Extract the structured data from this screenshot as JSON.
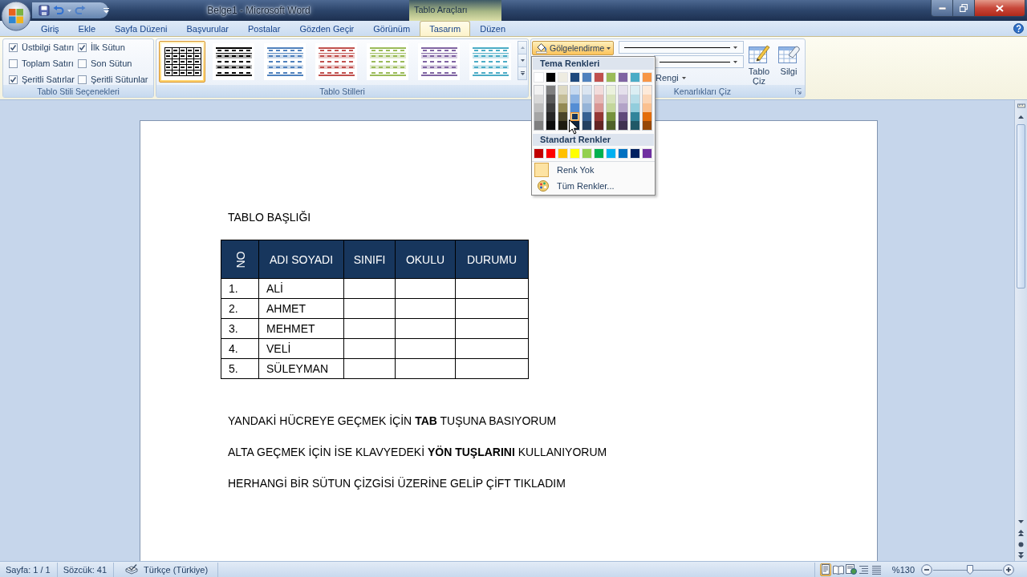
{
  "title_bar": {
    "title": "Belge1 - Microsoft Word",
    "context_label": "Tablo Araçları"
  },
  "tabs": [
    {
      "label": "Giriş",
      "selected": false
    },
    {
      "label": "Ekle",
      "selected": false
    },
    {
      "label": "Sayfa Düzeni",
      "selected": false
    },
    {
      "label": "Başvurular",
      "selected": false
    },
    {
      "label": "Postalar",
      "selected": false
    },
    {
      "label": "Gözden Geçir",
      "selected": false
    },
    {
      "label": "Görünüm",
      "selected": false
    },
    {
      "label": "Tasarım",
      "selected": true
    },
    {
      "label": "Düzen",
      "selected": false
    }
  ],
  "style_options": {
    "label": "Tablo Stili Seçenekleri",
    "options": [
      {
        "label": "Üstbilgi Satırı",
        "checked": true
      },
      {
        "label": "İlk Sütun",
        "checked": true
      },
      {
        "label": "Toplam Satırı",
        "checked": false
      },
      {
        "label": "Son Sütun",
        "checked": false
      },
      {
        "label": "Şeritli Satırlar",
        "checked": true
      },
      {
        "label": "Şeritli Sütunlar",
        "checked": false
      }
    ]
  },
  "table_styles": {
    "label": "Tablo Stilleri",
    "styles": [
      {
        "kind": "grid",
        "color": "#000000",
        "selected": true
      },
      {
        "kind": "banded",
        "color": "#000000",
        "selected": false
      },
      {
        "kind": "banded",
        "color": "#4f81bd",
        "selected": false
      },
      {
        "kind": "banded",
        "color": "#c0504d",
        "selected": false
      },
      {
        "kind": "banded",
        "color": "#9bbb59",
        "selected": false
      },
      {
        "kind": "banded",
        "color": "#8064a2",
        "selected": false
      },
      {
        "kind": "banded",
        "color": "#4bacc6",
        "selected": false
      }
    ]
  },
  "borders": {
    "label": "Kenarlıkları Çiz",
    "shading": {
      "label": "Gölgelendirme",
      "expanded": true
    },
    "pen_color": {
      "label": "Rengi"
    },
    "draw_table": {
      "label": "Tablo Çiz"
    },
    "eraser": {
      "label": "Silgi"
    }
  },
  "color_menu": {
    "theme_heading": "Tema Renkleri",
    "theme_colors": [
      {
        "color": "#ffffff",
        "selected": false
      },
      {
        "color": "#000000",
        "selected": false
      },
      {
        "color": "#eeece1",
        "selected": false
      },
      {
        "color": "#1f497d",
        "selected": false
      },
      {
        "color": "#4f81bd",
        "selected": false
      },
      {
        "color": "#c0504d",
        "selected": false
      },
      {
        "color": "#9bbb59",
        "selected": false
      },
      {
        "color": "#8064a2",
        "selected": false
      },
      {
        "color": "#4bacc6",
        "selected": false
      },
      {
        "color": "#f79646",
        "selected": false
      }
    ],
    "theme_shades": [
      [
        {
          "color": "#f2f2f2",
          "selected": false
        },
        {
          "color": "#7f7f7f",
          "selected": false
        },
        {
          "color": "#ddd9c3",
          "selected": false
        },
        {
          "color": "#c6d9f0",
          "selected": false
        },
        {
          "color": "#dbe5f1",
          "selected": false
        },
        {
          "color": "#f2dcdb",
          "selected": false
        },
        {
          "color": "#ebf1dd",
          "selected": false
        },
        {
          "color": "#e5e0ec",
          "selected": false
        },
        {
          "color": "#dbeef3",
          "selected": false
        },
        {
          "color": "#fdeada",
          "selected": false
        }
      ],
      [
        {
          "color": "#d8d8d8",
          "selected": false
        },
        {
          "color": "#595959",
          "selected": false
        },
        {
          "color": "#c4bd97",
          "selected": false
        },
        {
          "color": "#8db3e2",
          "selected": false
        },
        {
          "color": "#b8cce4",
          "selected": false
        },
        {
          "color": "#e5b9b7",
          "selected": false
        },
        {
          "color": "#d7e3bc",
          "selected": false
        },
        {
          "color": "#ccc1d9",
          "selected": false
        },
        {
          "color": "#b7dde8",
          "selected": false
        },
        {
          "color": "#fbd5b5",
          "selected": false
        }
      ],
      [
        {
          "color": "#bfbfbf",
          "selected": false
        },
        {
          "color": "#3f3f3f",
          "selected": false
        },
        {
          "color": "#938953",
          "selected": false
        },
        {
          "color": "#548dd4",
          "selected": false
        },
        {
          "color": "#95b3d7",
          "selected": false
        },
        {
          "color": "#d99694",
          "selected": false
        },
        {
          "color": "#c3d69b",
          "selected": false
        },
        {
          "color": "#b2a2c7",
          "selected": false
        },
        {
          "color": "#92cddc",
          "selected": false
        },
        {
          "color": "#fac08f",
          "selected": false
        }
      ],
      [
        {
          "color": "#a5a5a5",
          "selected": false
        },
        {
          "color": "#262626",
          "selected": false
        },
        {
          "color": "#494429",
          "selected": false
        },
        {
          "color": "#17365d",
          "selected": true
        },
        {
          "color": "#366092",
          "selected": false
        },
        {
          "color": "#953734",
          "selected": false
        },
        {
          "color": "#76923c",
          "selected": false
        },
        {
          "color": "#5f497a",
          "selected": false
        },
        {
          "color": "#31859b",
          "selected": false
        },
        {
          "color": "#e36c09",
          "selected": false
        }
      ],
      [
        {
          "color": "#7f7f7f",
          "selected": false
        },
        {
          "color": "#0c0c0c",
          "selected": false
        },
        {
          "color": "#1d1b10",
          "selected": false
        },
        {
          "color": "#0f243e",
          "selected": false
        },
        {
          "color": "#244061",
          "selected": false
        },
        {
          "color": "#632423",
          "selected": false
        },
        {
          "color": "#4f6128",
          "selected": false
        },
        {
          "color": "#3f3151",
          "selected": false
        },
        {
          "color": "#205867",
          "selected": false
        },
        {
          "color": "#974806",
          "selected": false
        }
      ]
    ],
    "standard_heading": "Standart Renkler",
    "standard_colors": [
      {
        "color": "#c00000",
        "selected": false
      },
      {
        "color": "#ff0000",
        "selected": false
      },
      {
        "color": "#ffc000",
        "selected": false
      },
      {
        "color": "#ffff00",
        "selected": false
      },
      {
        "color": "#92d050",
        "selected": false
      },
      {
        "color": "#00b050",
        "selected": false
      },
      {
        "color": "#00b0f0",
        "selected": false
      },
      {
        "color": "#0070c0",
        "selected": false
      },
      {
        "color": "#002060",
        "selected": false
      },
      {
        "color": "#7030a0",
        "selected": false
      }
    ],
    "no_color": "Renk Yok",
    "more_colors": "Tüm Renkler..."
  },
  "document": {
    "heading": "TABLO BAŞLIĞI",
    "table": {
      "columns": [
        {
          "label": "NO",
          "vertical": true
        },
        {
          "label": "ADI SOYADI",
          "vertical": false
        },
        {
          "label": "SINIFI",
          "vertical": false
        },
        {
          "label": "OKULU",
          "vertical": false
        },
        {
          "label": "DURUMU",
          "vertical": false
        }
      ],
      "rows": [
        [
          "1.",
          "ALİ"
        ],
        [
          "2.",
          "AHMET"
        ],
        [
          "3.",
          "MEHMET"
        ],
        [
          "4.",
          "VELİ"
        ],
        [
          "5.",
          "SÜLEYMAN"
        ]
      ]
    },
    "paragraphs": [
      "YANDAKİ HÜCREYE GEÇMEK İÇİN **TAB** TUŞUNA BASIYORUM",
      "ALTA GEÇMEK İÇİN İSE KLAVYEDEKİ **YÖN TUŞLARINI** KULLANIYORUM",
      "HERHANGİ BİR SÜTUN ÇİZGİSİ ÜZERİNE GELİP ÇİFT TIKLADIM"
    ]
  },
  "status_bar": {
    "page": "Sayfa: 1 / 1",
    "words": "Sözcük: 41",
    "language": "Türkçe (Türkiye)",
    "views": [
      {
        "kind": "print",
        "selected": true
      },
      {
        "kind": "reading",
        "selected": false
      },
      {
        "kind": "web",
        "selected": false
      },
      {
        "kind": "outline",
        "selected": false
      },
      {
        "kind": "draft",
        "selected": false
      }
    ],
    "zoom": "%130",
    "zoom_slider": {
      "level": 0.53
    }
  }
}
